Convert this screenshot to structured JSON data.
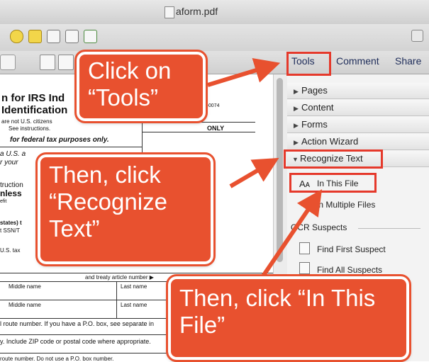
{
  "window": {
    "title": "aform.pdf"
  },
  "panel": {
    "tabs": [
      "Tools",
      "Comment",
      "Share"
    ],
    "sections": [
      "Pages",
      "Content",
      "Forms",
      "Action Wizard",
      "Recognize Text"
    ],
    "recognize_text_items": [
      "In This File",
      "In Multiple Files"
    ],
    "ocr_header": "OCR Suspects",
    "ocr_items": [
      "Find First Suspect",
      "Find All Suspects"
    ]
  },
  "document": {
    "heading1": "n for IRS Ind",
    "heading2": "Identification",
    "note1": "are not U.S. citizens",
    "note2": "See instructions.",
    "omb": "1545-0074",
    "subtitle": "for federal tax purposes only.",
    "only": "ONLY",
    "frag1": "a U.S. a",
    "frag2": "r your",
    "frag3": "truction",
    "frag4": "nless",
    "frag5": "efit",
    "frag6": "states) t",
    "frag7": "t SSN/T",
    "frag8": "U.S. tax",
    "treaty": "and treaty article number ▶",
    "middle1": "Middle name",
    "last1": "Last name",
    "middle2": "Middle name",
    "last2": "Last name",
    "route": "l route number. If you have a P.O. box, see separate in",
    "zip": "y. Include ZIP code or postal code where appropriate.",
    "bottom": "route number. Do not use a P.O. box number."
  },
  "callouts": {
    "tools": "Click on “Tools”",
    "recognize": "Then, click “Recognize Text”",
    "in_this_file": "Then, click “In This File”"
  },
  "colors": {
    "callout": "#e8512f",
    "highlight": "#e5392b",
    "tab_text": "#1f2d5a"
  }
}
